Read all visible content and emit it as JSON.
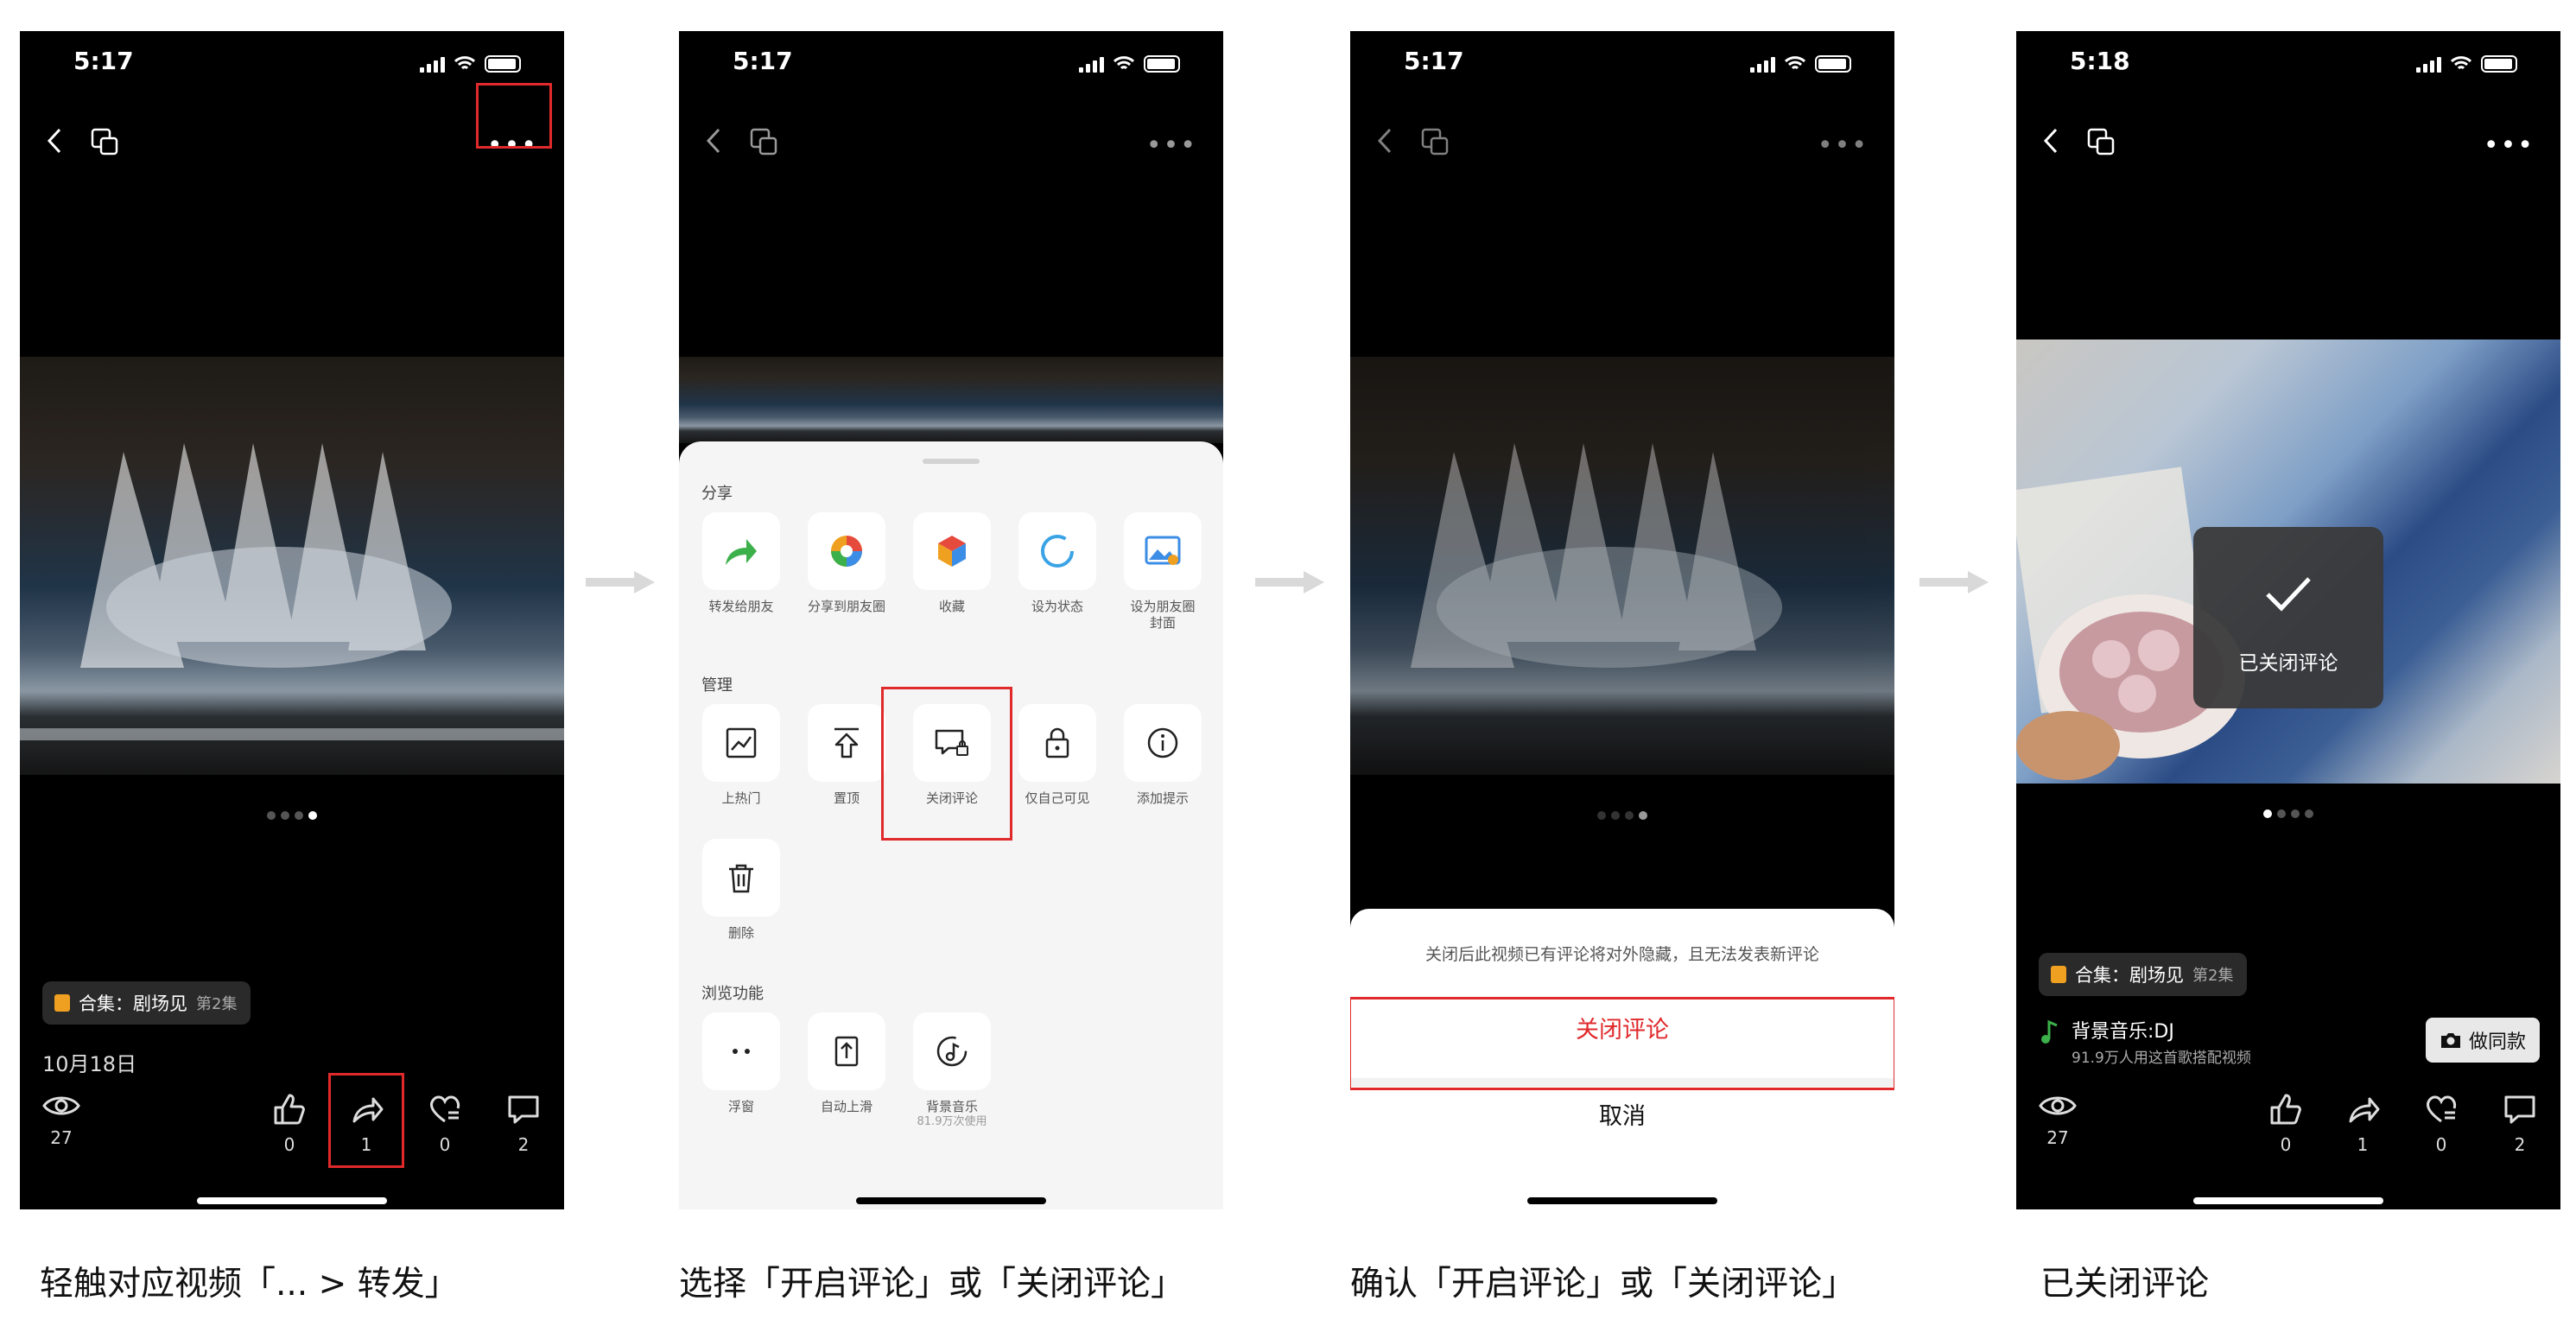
{
  "steps": [
    {
      "time": "5:17",
      "collection": {
        "label": "合集：剧场见",
        "episode": "第2集"
      },
      "date": "10月18日",
      "stats": {
        "views": "27",
        "likes": "0",
        "shares": "1",
        "favs": "0",
        "comments": "2"
      },
      "caption": "轻触对应视频「... > 转发」"
    },
    {
      "time": "5:17",
      "sections": {
        "share": "分享",
        "manage": "管理",
        "browse": "浏览功能"
      },
      "share_items": [
        "转发给朋友",
        "分享到朋友圈",
        "收藏",
        "设为状态",
        "设为朋友圈\n封面"
      ],
      "manage_items": [
        "上热门",
        "置顶",
        "关闭评论",
        "仅自己可见",
        "添加提示",
        "删除"
      ],
      "browse_items": [
        "浮窗",
        "自动上滑",
        "背景音乐"
      ],
      "bgm_sub": "81.9万次使用",
      "caption": "选择「开启评论」或「关闭评论」"
    },
    {
      "time": "5:17",
      "message": "关闭后此视频已有评论将对外隐藏，且无法发表新评论",
      "confirm_label": "关闭评论",
      "cancel_label": "取消",
      "caption": "确认「开启评论」或「关闭评论」"
    },
    {
      "time": "5:18",
      "toast": "已关闭评论",
      "collection": {
        "label": "合集：剧场见",
        "episode": "第2集"
      },
      "music": {
        "name": "背景音乐:DJ",
        "count": "91.9万人用这首歌搭配视频"
      },
      "same_label": "做同款",
      "stats": {
        "views": "27",
        "likes": "0",
        "shares": "1",
        "favs": "0",
        "comments": "2"
      },
      "caption": "已关闭评论"
    }
  ],
  "colors": {
    "highlight": "#e0292b",
    "arrow": "#d9d9d9"
  }
}
